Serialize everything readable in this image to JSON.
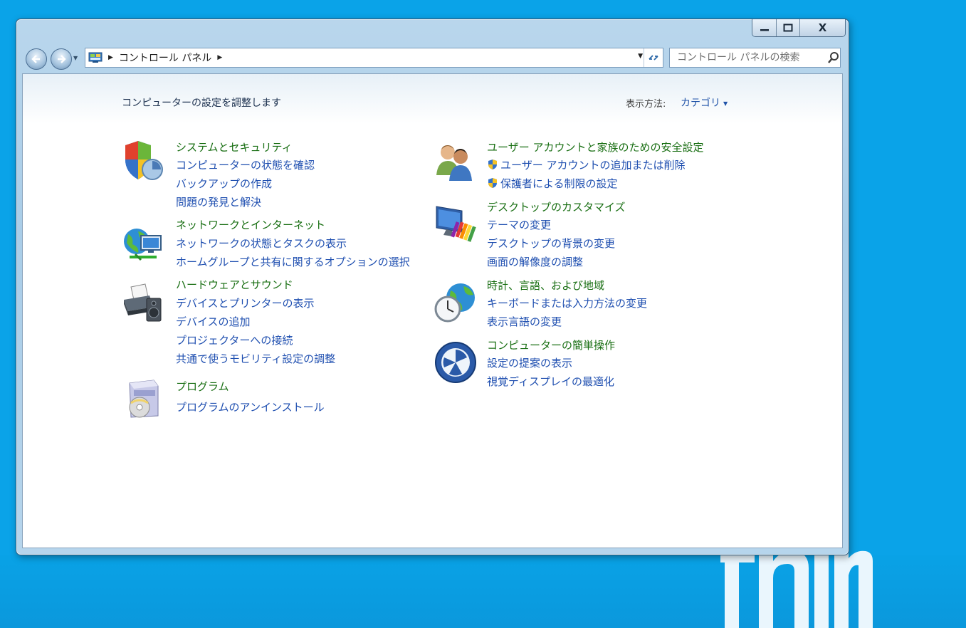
{
  "window": {
    "caption": {
      "minimize_icon": "minimize-icon",
      "maximize_icon": "maximize-icon",
      "close_label": "X"
    }
  },
  "toolbar": {
    "breadcrumb_root": "コントロール パネル",
    "search_placeholder": "コントロール パネルの検索"
  },
  "content": {
    "title": "コンピューターの設定を調整します",
    "view_label": "表示方法:",
    "view_value": "カテゴリ"
  },
  "categories": {
    "system": {
      "title": "システムとセキュリティ",
      "icon": "security-shield-icon",
      "links": [
        "コンピューターの状態を確認",
        "バックアップの作成",
        "問題の発見と解決"
      ]
    },
    "network": {
      "title": "ネットワークとインターネット",
      "icon": "network-globe-icon",
      "links": [
        "ネットワークの状態とタスクの表示",
        "ホームグループと共有に関するオプションの選択"
      ]
    },
    "hardware": {
      "title": "ハードウェアとサウンド",
      "icon": "printer-speaker-icon",
      "links": [
        "デバイスとプリンターの表示",
        "デバイスの追加",
        "プロジェクターへの接続",
        "共通で使うモビリティ設定の調整"
      ]
    },
    "programs": {
      "title": "プログラム",
      "icon": "program-disc-icon",
      "links": [
        "プログラムのアンインストール"
      ]
    },
    "users": {
      "title": "ユーザー アカウントと家族のための安全設定",
      "icon": "user-accounts-icon",
      "links": [
        "ユーザー アカウントの追加または削除",
        "保護者による制限の設定"
      ]
    },
    "appearance": {
      "title": "デスクトップのカスタマイズ",
      "icon": "desktop-personalize-icon",
      "links": [
        "テーマの変更",
        "デスクトップの背景の変更",
        "画面の解像度の調整"
      ]
    },
    "clock": {
      "title": "時計、言語、および地域",
      "icon": "clock-globe-icon",
      "links": [
        "キーボードまたは入力方法の変更",
        "表示言語の変更"
      ]
    },
    "ease": {
      "title": "コンピューターの簡単操作",
      "icon": "ease-of-access-icon",
      "links": [
        "設定の提案の表示",
        "視覚ディスプレイの最適化"
      ]
    }
  },
  "colors": {
    "desktop": "#0aa3e8",
    "category_title": "#186e12",
    "link": "#1f4fb0"
  }
}
